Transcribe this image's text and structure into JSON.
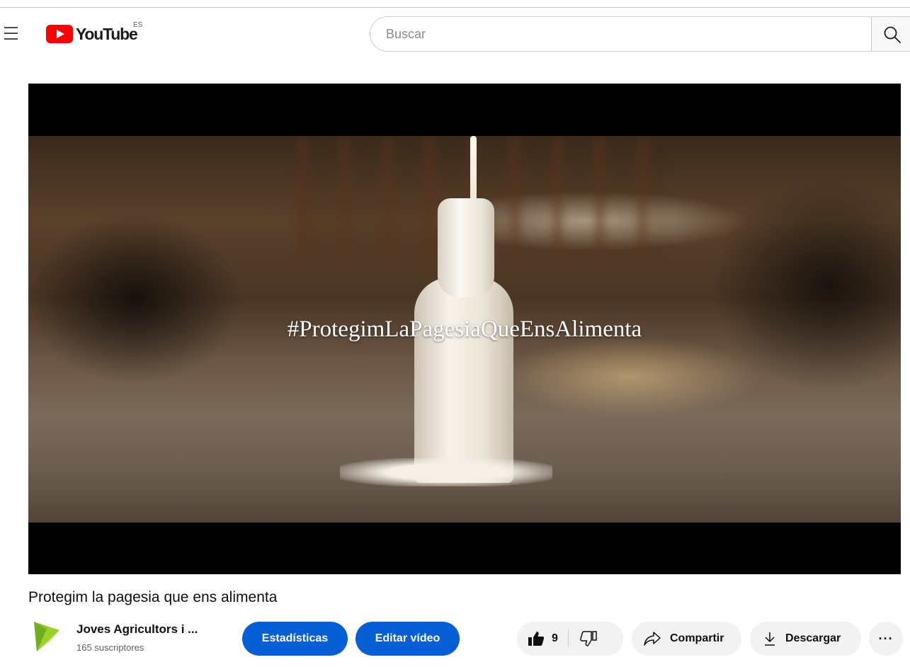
{
  "header": {
    "logo_text": "YouTube",
    "country_code": "ES",
    "search_placeholder": "Buscar"
  },
  "player": {
    "overlay_text": "#ProtegimLaPagesiaQueEnsAlimenta"
  },
  "video": {
    "title": "Protegim la pagesia que ens alimenta"
  },
  "channel": {
    "name": "Joves Agricultors i ...",
    "subscribers": "165 suscriptores"
  },
  "actions": {
    "stats_label": "Estadísticas",
    "edit_label": "Editar vídeo",
    "like_count": "9",
    "share_label": "Compartir",
    "download_label": "Descargar",
    "more_label": "···"
  },
  "colors": {
    "brand_red": "#ff0000",
    "action_blue": "#065fd4",
    "pill_bg": "#f2f2f2"
  },
  "icons": [
    "menu-icon",
    "youtube-logo-icon",
    "search-icon",
    "thumbs-up-icon",
    "thumbs-down-icon",
    "share-icon",
    "download-icon",
    "more-icon"
  ]
}
